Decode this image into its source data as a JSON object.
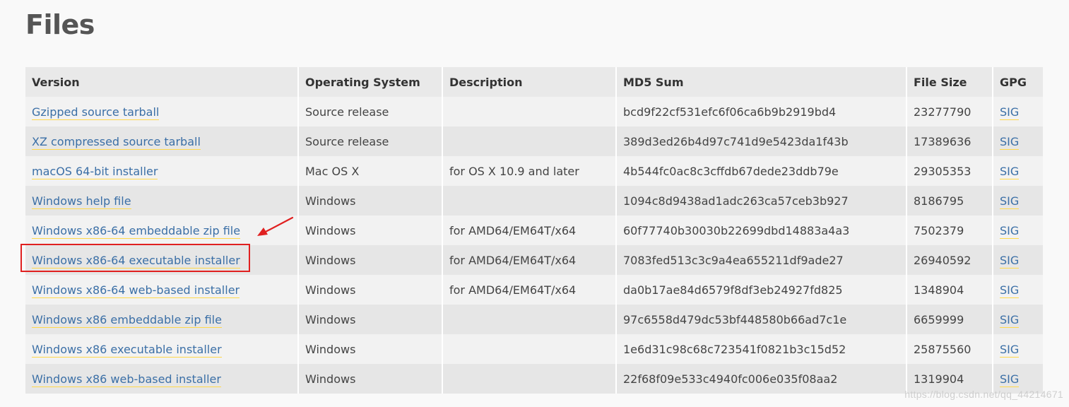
{
  "page": {
    "title": "Files"
  },
  "table": {
    "headers": [
      "Version",
      "Operating System",
      "Description",
      "MD5 Sum",
      "File Size",
      "GPG"
    ],
    "rows": [
      {
        "version": "Gzipped source tarball",
        "os": "Source release",
        "description": "",
        "md5": "bcd9f22cf531efc6f06ca6b9b2919bd4",
        "size": "23277790",
        "gpg": "SIG"
      },
      {
        "version": "XZ compressed source tarball",
        "os": "Source release",
        "description": "",
        "md5": "389d3ed26b4d97c741d9e5423da1f43b",
        "size": "17389636",
        "gpg": "SIG"
      },
      {
        "version": "macOS 64-bit installer",
        "os": "Mac OS X",
        "description": "for OS X 10.9 and later",
        "md5": "4b544fc0ac8c3cffdb67dede23ddb79e",
        "size": "29305353",
        "gpg": "SIG"
      },
      {
        "version": "Windows help file",
        "os": "Windows",
        "description": "",
        "md5": "1094c8d9438ad1adc263ca57ceb3b927",
        "size": "8186795",
        "gpg": "SIG"
      },
      {
        "version": "Windows x86-64 embeddable zip file",
        "os": "Windows",
        "description": "for AMD64/EM64T/x64",
        "md5": "60f77740b30030b22699dbd14883a4a3",
        "size": "7502379",
        "gpg": "SIG"
      },
      {
        "version": "Windows x86-64 executable installer",
        "os": "Windows",
        "description": "for AMD64/EM64T/x64",
        "md5": "7083fed513c3c9a4ea655211df9ade27",
        "size": "26940592",
        "gpg": "SIG"
      },
      {
        "version": "Windows x86-64 web-based installer",
        "os": "Windows",
        "description": "for AMD64/EM64T/x64",
        "md5": "da0b17ae84d6579f8df3eb24927fd825",
        "size": "1348904",
        "gpg": "SIG"
      },
      {
        "version": "Windows x86 embeddable zip file",
        "os": "Windows",
        "description": "",
        "md5": "97c6558d479dc53bf448580b66ad7c1e",
        "size": "6659999",
        "gpg": "SIG"
      },
      {
        "version": "Windows x86 executable installer",
        "os": "Windows",
        "description": "",
        "md5": "1e6d31c98c68c723541f0821b3c15d52",
        "size": "25875560",
        "gpg": "SIG"
      },
      {
        "version": "Windows x86 web-based installer",
        "os": "Windows",
        "description": "",
        "md5": "22f68f09e533c4940fc006e035f08aa2",
        "size": "1319904",
        "gpg": "SIG"
      }
    ]
  },
  "annotation": {
    "color": "#e02020"
  },
  "watermark": {
    "text": "https://blog.csdn.net/qq_44214671"
  },
  "colors": {
    "link": "#3b6fa6",
    "link_underline": "#ffd84a",
    "header_bg": "#e9e9e9",
    "row_odd_bg": "#f2f2f2",
    "row_even_bg": "#e6e6e6",
    "title": "#555555"
  }
}
